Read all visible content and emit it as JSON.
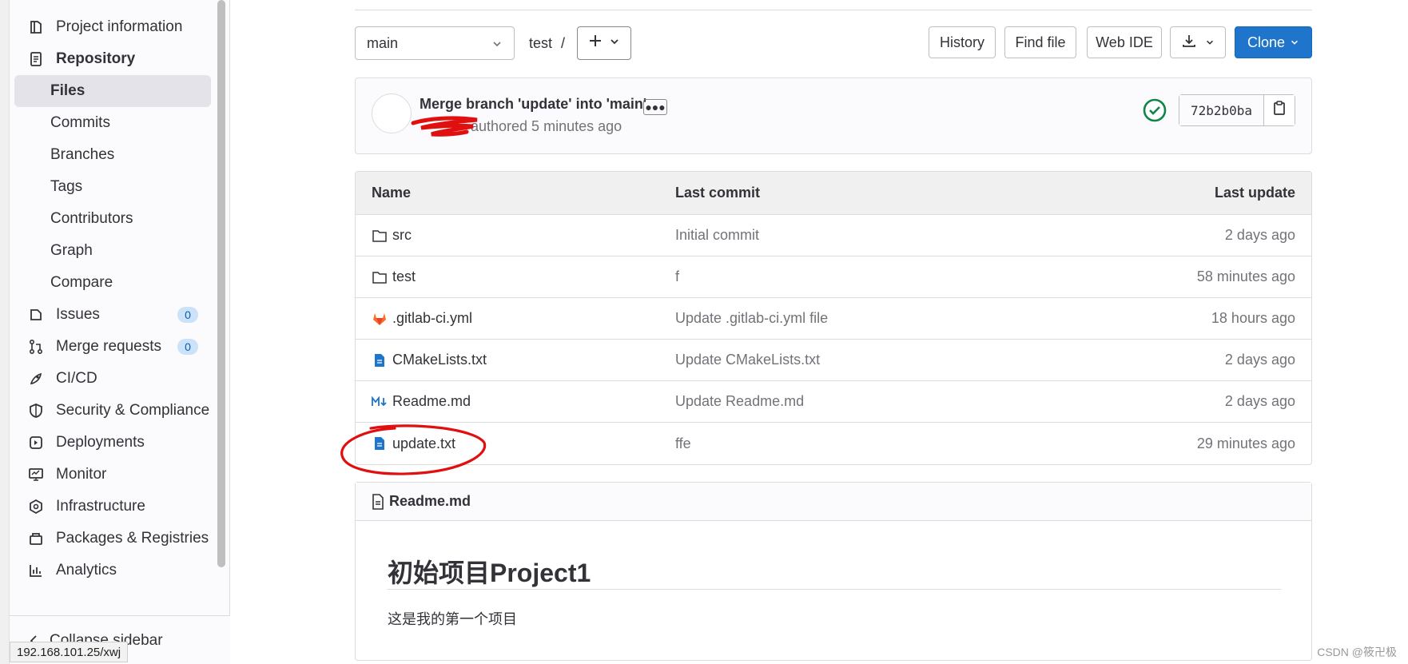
{
  "sidebar": {
    "items": [
      {
        "label": "Project information",
        "icon": "project-icon"
      },
      {
        "label": "Repository",
        "icon": "repository-icon"
      },
      {
        "label": "Files",
        "sub": true
      },
      {
        "label": "Commits",
        "sub": true
      },
      {
        "label": "Branches",
        "sub": true
      },
      {
        "label": "Tags",
        "sub": true
      },
      {
        "label": "Contributors",
        "sub": true
      },
      {
        "label": "Graph",
        "sub": true
      },
      {
        "label": "Compare",
        "sub": true
      },
      {
        "label": "Issues",
        "icon": "issues-icon",
        "badge": "0"
      },
      {
        "label": "Merge requests",
        "icon": "merge-request-icon",
        "badge": "0"
      },
      {
        "label": "CI/CD",
        "icon": "rocket-icon"
      },
      {
        "label": "Security & Compliance",
        "icon": "shield-icon"
      },
      {
        "label": "Deployments",
        "icon": "deployments-icon"
      },
      {
        "label": "Monitor",
        "icon": "monitor-icon"
      },
      {
        "label": "Infrastructure",
        "icon": "infrastructure-icon"
      },
      {
        "label": "Packages & Registries",
        "icon": "package-icon"
      },
      {
        "label": "Analytics",
        "icon": "analytics-icon"
      }
    ],
    "collapse_label": "Collapse sidebar",
    "status_url": "192.168.101.25/xwj"
  },
  "toolbar": {
    "branch": "main",
    "path": "test",
    "path_sep": "/",
    "history": "History",
    "find_file": "Find file",
    "web_ide": "Web IDE",
    "clone": "Clone"
  },
  "commit": {
    "title": "Merge branch 'update' into 'main'",
    "meta": "authored 5 minutes ago",
    "sha": "72b2b0ba",
    "status_color": "#108548"
  },
  "table": {
    "headers": {
      "name": "Name",
      "last_commit": "Last commit",
      "last_update": "Last update"
    },
    "rows": [
      {
        "name": "src",
        "icon": "folder-icon",
        "commit": "Initial commit",
        "updated": "2 days ago"
      },
      {
        "name": "test",
        "icon": "folder-icon",
        "commit": "f",
        "updated": "58 minutes ago"
      },
      {
        "name": ".gitlab-ci.yml",
        "icon": "gitlab-icon",
        "commit": "Update .gitlab-ci.yml file",
        "updated": "18 hours ago"
      },
      {
        "name": "CMakeLists.txt",
        "icon": "file-icon",
        "commit": "Update CMakeLists.txt",
        "updated": "2 days ago"
      },
      {
        "name": "Readme.md",
        "icon": "markdown-icon",
        "commit": "Update Readme.md",
        "updated": "2 days ago"
      },
      {
        "name": "update.txt",
        "icon": "file-icon",
        "commit": "ffe",
        "updated": "29 minutes ago"
      }
    ]
  },
  "readme": {
    "filename": "Readme.md",
    "heading": "初始项目Project1",
    "paragraph": "这是我的第一个项目"
  },
  "watermark": "CSDN @筱卍极",
  "colors": {
    "accent": "#1f75cb",
    "annotation": "#e01010"
  }
}
